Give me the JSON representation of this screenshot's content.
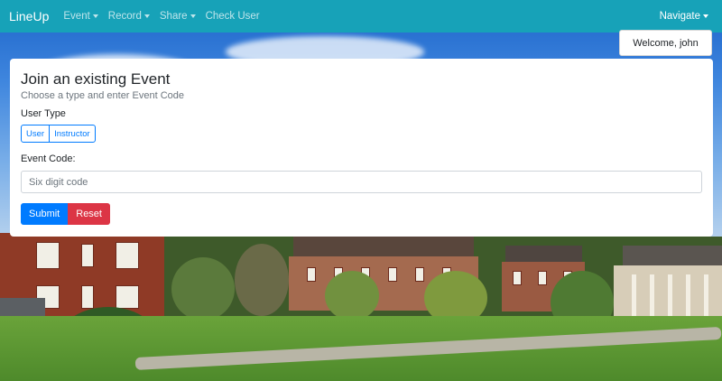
{
  "navbar": {
    "brand": "LineUp",
    "items": [
      {
        "label": "Event",
        "dropdown": true
      },
      {
        "label": "Record",
        "dropdown": true
      },
      {
        "label": "Share",
        "dropdown": true
      },
      {
        "label": "Check User",
        "dropdown": false
      }
    ],
    "right_menu": "Navigate"
  },
  "welcome": "Welcome, john",
  "card": {
    "title": "Join an existing Event",
    "subtitle": "Choose a type and enter Event Code",
    "user_type_label": "User Type",
    "user_type_options": [
      "User",
      "Instructor"
    ],
    "event_code_label": "Event Code:",
    "event_code_placeholder": "Six digit code",
    "event_code_value": "",
    "submit_label": "Submit",
    "reset_label": "Reset"
  },
  "colors": {
    "navbar_bg": "#17a2b8",
    "primary": "#007bff",
    "danger": "#dc3545"
  },
  "icons": {
    "dropdown": "caret-down-icon"
  }
}
